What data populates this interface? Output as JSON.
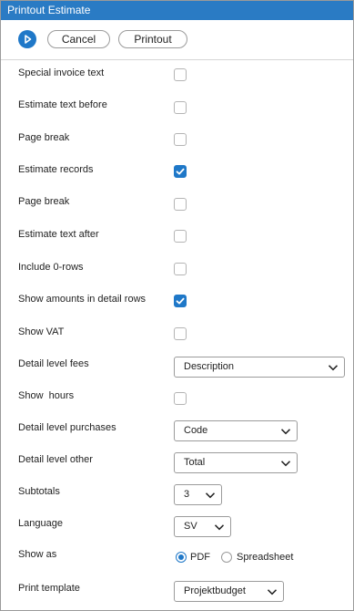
{
  "window": {
    "title": "Printout Estimate"
  },
  "toolbar": {
    "cancel_label": "Cancel",
    "printout_label": "Printout"
  },
  "fields": {
    "special_invoice_text": {
      "label": "Special invoice text",
      "checked": false
    },
    "estimate_text_before": {
      "label": "Estimate text before",
      "checked": false
    },
    "page_break_1": {
      "label": "Page break",
      "checked": false
    },
    "estimate_records": {
      "label": "Estimate records",
      "checked": true
    },
    "page_break_2": {
      "label": "Page break",
      "checked": false
    },
    "estimate_text_after": {
      "label": "Estimate text after",
      "checked": false
    },
    "include_zero_rows": {
      "label": "Include 0-rows",
      "checked": false
    },
    "show_amounts_detail": {
      "label": "Show amounts in detail rows",
      "checked": true
    },
    "show_vat": {
      "label": "Show VAT",
      "checked": false
    },
    "detail_level_fees": {
      "label": "Detail level fees",
      "value": "Description"
    },
    "show_hours": {
      "label": "Show  hours",
      "checked": false
    },
    "detail_level_purchases": {
      "label": "Detail level purchases",
      "value": "Code"
    },
    "detail_level_other": {
      "label": "Detail level other",
      "value": "Total"
    },
    "subtotals": {
      "label": "Subtotals",
      "value": "3"
    },
    "language": {
      "label": "Language",
      "value": "SV"
    },
    "show_as": {
      "label": "Show as",
      "options": [
        "PDF",
        "Spreadsheet"
      ],
      "selected": "PDF"
    },
    "print_template": {
      "label": "Print template",
      "value": "Projektbudget"
    }
  },
  "colors": {
    "accent": "#1f78c8",
    "titlebar": "#2a7bc4"
  },
  "icons": {
    "run": "play-circle-icon",
    "dropdown": "chevron-down-icon",
    "check": "checkmark-icon"
  }
}
